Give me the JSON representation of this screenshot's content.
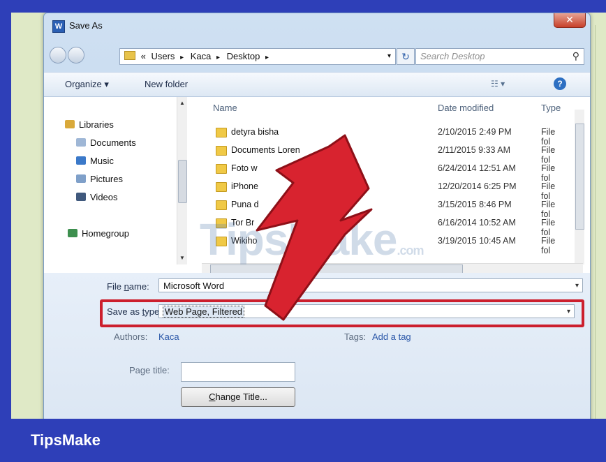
{
  "window": {
    "title": "Save As",
    "app_icon_letter": "W",
    "close_glyph": "✕"
  },
  "address": {
    "crumbs": [
      "«",
      "Users",
      "Kaca",
      "Desktop"
    ],
    "separator": "▸",
    "dropdown": "▾",
    "refresh_glyph": "↻",
    "search_placeholder": "Search Desktop",
    "search_glyph": "⚲"
  },
  "toolbar": {
    "organize": "Organize ▾",
    "new_folder": "New folder",
    "view_glyph": "☷ ▾",
    "help": "?"
  },
  "sidebar": {
    "items": [
      {
        "label": "Libraries",
        "icon": "libraries-icon",
        "color": "#d9a93a"
      },
      {
        "label": "Documents",
        "icon": "documents-icon",
        "color": "#9fb7d6"
      },
      {
        "label": "Music",
        "icon": "music-icon",
        "color": "#3b79c9"
      },
      {
        "label": "Pictures",
        "icon": "pictures-icon",
        "color": "#7fa0c9"
      },
      {
        "label": "Videos",
        "icon": "videos-icon",
        "color": "#40597d"
      },
      {
        "label": "Homegroup",
        "icon": "homegroup-icon",
        "color": "#3d8f4e"
      }
    ]
  },
  "columns": {
    "name": "Name",
    "date": "Date modified",
    "type": "Type"
  },
  "files": [
    {
      "name": "detyra bisha",
      "date": "2/10/2015 2:49 PM",
      "type": "File fol"
    },
    {
      "name": "Documents Loren",
      "date": "2/11/2015 9:33 AM",
      "type": "File fol"
    },
    {
      "name": "Foto w",
      "date": "6/24/2014 12:51 AM",
      "type": "File fol"
    },
    {
      "name": "iPhone",
      "date": "12/20/2014 6:25 PM",
      "type": "File fol"
    },
    {
      "name": "Puna d",
      "date": "3/15/2015 8:46 PM",
      "type": "File fol"
    },
    {
      "name": "Tor Br",
      "date": "6/16/2014 10:52 AM",
      "type": "File fol"
    },
    {
      "name": "Wikiho",
      "date": "3/19/2015 10:45 AM",
      "type": "File fol"
    }
  ],
  "form": {
    "file_name_label_pre": "File ",
    "file_name_label_u": "n",
    "file_name_label_post": "ame:",
    "file_name_value": "Microsoft Word",
    "save_type_label_pre": "Save as ",
    "save_type_label_u": "t",
    "save_type_label_post": "ype:",
    "save_type_value": "Web Page, Filtered",
    "authors_label": "Authors:",
    "authors_value": "Kaca",
    "tags_label": "Tags:",
    "tags_value": "Add a tag",
    "page_title_label": "Page title:",
    "page_title_value": "",
    "change_title_pre": "",
    "change_title_u": "C",
    "change_title_post": "hange Title..."
  },
  "watermark": {
    "text": "TipsMake",
    "suffix": ".com"
  },
  "banner": {
    "text": "TipsMake"
  },
  "colors": {
    "highlight": "#cc1f2d",
    "arrow": "#d8232f",
    "banner": "#2e3fb8"
  }
}
